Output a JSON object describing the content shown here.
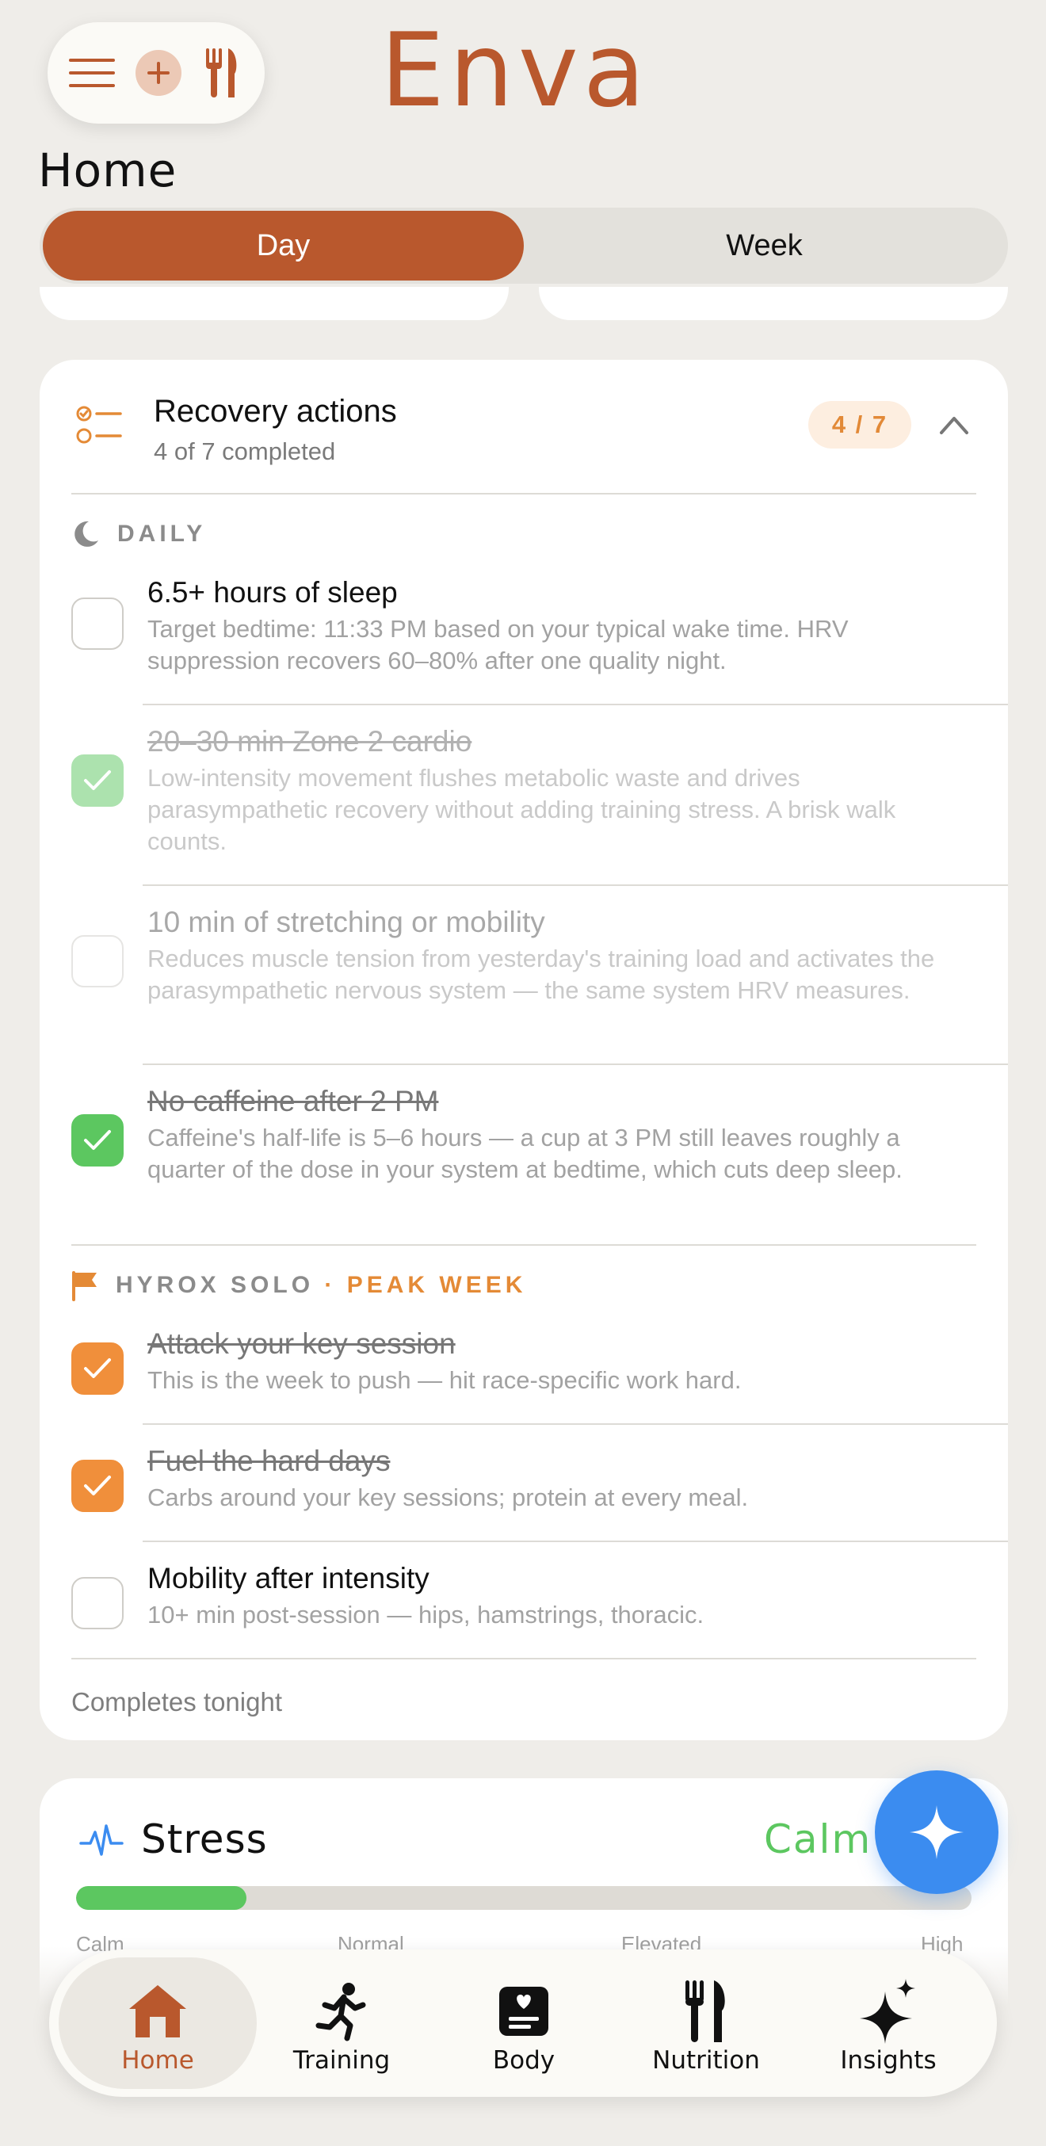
{
  "brand": "Enva",
  "page_title": "Home",
  "segments": [
    "Day",
    "Week"
  ],
  "recovery": {
    "title": "Recovery actions",
    "subtitle": "4 of 7 completed",
    "count_badge": "4 / 7",
    "section_daily": "DAILY",
    "section_plan": "HYROX SOLO",
    "section_plan_accent": "· PEAK WEEK",
    "items": [
      {
        "title": "6.5+ hours of sleep",
        "desc": "Target bedtime: 11:33 PM based on your typical wake time. HRV suppression recovers 60–80% after one quality night.",
        "checked": false
      },
      {
        "title": "20–30 min Zone 2 cardio",
        "desc": "Low-intensity movement flushes metabolic waste and drives parasympathetic recovery without adding training stress. A brisk walk counts.",
        "checked": true
      },
      {
        "title": "10 min of stretching or mobility",
        "desc": "Reduces muscle tension from yesterday's training load and activates the parasympathetic nervous system — the same system HRV measures.",
        "checked": false
      },
      {
        "title": "No caffeine after 2 PM",
        "desc": "Caffeine's half-life is 5–6 hours — a cup at 3 PM still leaves roughly a quarter of the dose in your system at bedtime, which cuts deep sleep.",
        "checked": true
      },
      {
        "title": "Attack your key session",
        "desc": "This is the week to push — hit race-specific work hard.",
        "checked": true
      },
      {
        "title": "Fuel the hard days",
        "desc": "Carbs around your key sessions; protein at every meal.",
        "checked": true
      },
      {
        "title": "Mobility after intensity",
        "desc": "10+ min post-session — hips, hamstrings, thoracic.",
        "checked": false
      }
    ],
    "footer": "Completes tonight"
  },
  "stress": {
    "title": "Stress",
    "status": "Calm",
    "level": 0.19,
    "scale": [
      "Calm",
      "Normal",
      "Elevated",
      "High"
    ]
  },
  "nav": [
    {
      "label": "Home",
      "icon": "home-icon",
      "active": true
    },
    {
      "label": "Training",
      "icon": "runner-icon",
      "active": false
    },
    {
      "label": "Body",
      "icon": "body-card-icon",
      "active": false
    },
    {
      "label": "Nutrition",
      "icon": "fork-knife-icon",
      "active": false
    },
    {
      "label": "Insights",
      "icon": "sparkle-icon",
      "active": false
    }
  ],
  "colors": {
    "brand": "#b9582d",
    "background": "#efede9",
    "done_green": "#5cc760",
    "plan_orange": "#f08f3b",
    "fab_blue": "#3b8cf0"
  }
}
